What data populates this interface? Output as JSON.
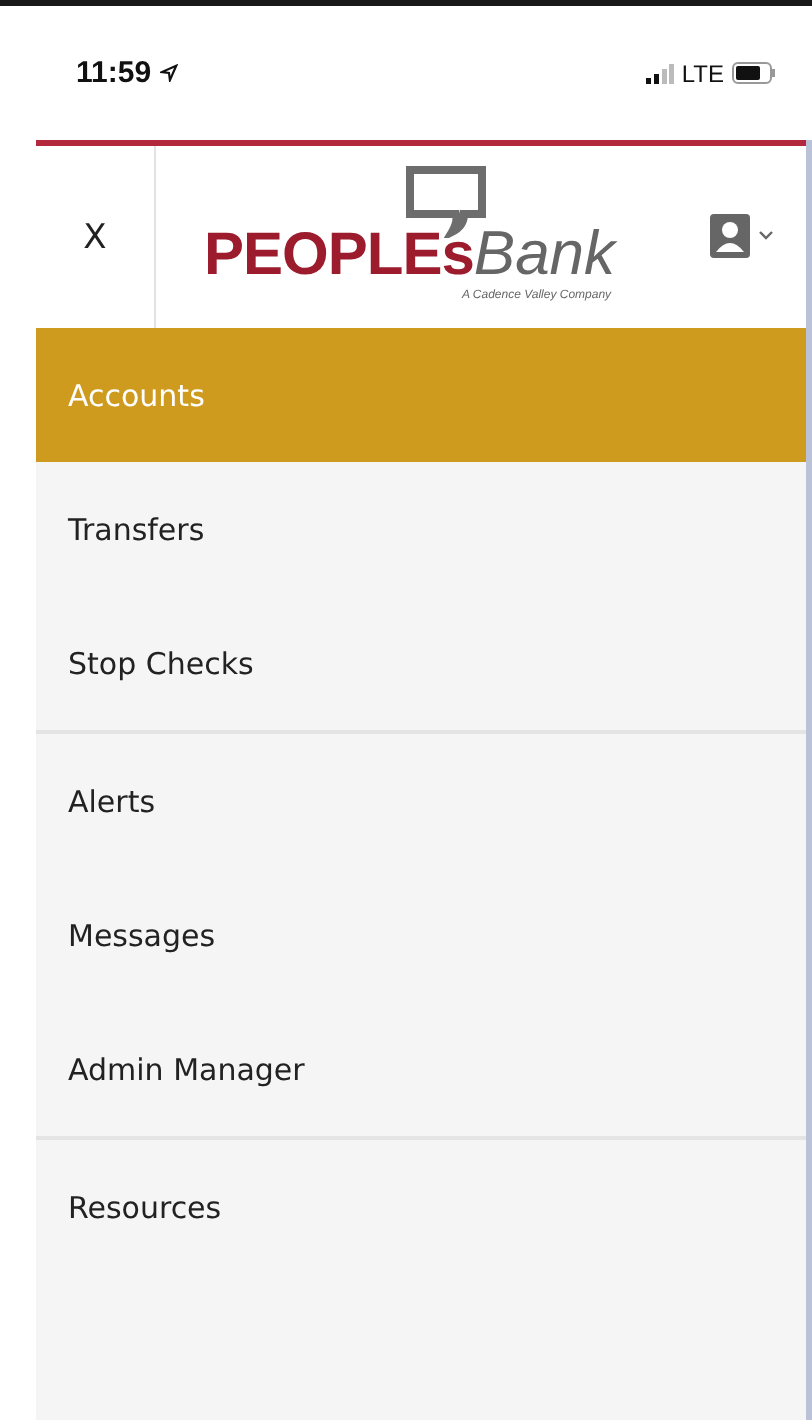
{
  "status_bar": {
    "time": "11:59",
    "network": "LTE"
  },
  "header": {
    "close": "X",
    "logo": {
      "primary": "PEOPLEs",
      "secondary": "Bank",
      "tagline": "A Cadence Valley Company"
    }
  },
  "menu_groups": [
    {
      "items": [
        {
          "label": "Accounts",
          "selected": true
        },
        {
          "label": "Transfers",
          "selected": false
        },
        {
          "label": "Stop Checks",
          "selected": false
        }
      ]
    },
    {
      "items": [
        {
          "label": "Alerts",
          "selected": false
        },
        {
          "label": "Messages",
          "selected": false
        },
        {
          "label": "Admin Manager",
          "selected": false
        }
      ]
    },
    {
      "items": [
        {
          "label": "Resources",
          "selected": false
        }
      ]
    }
  ]
}
